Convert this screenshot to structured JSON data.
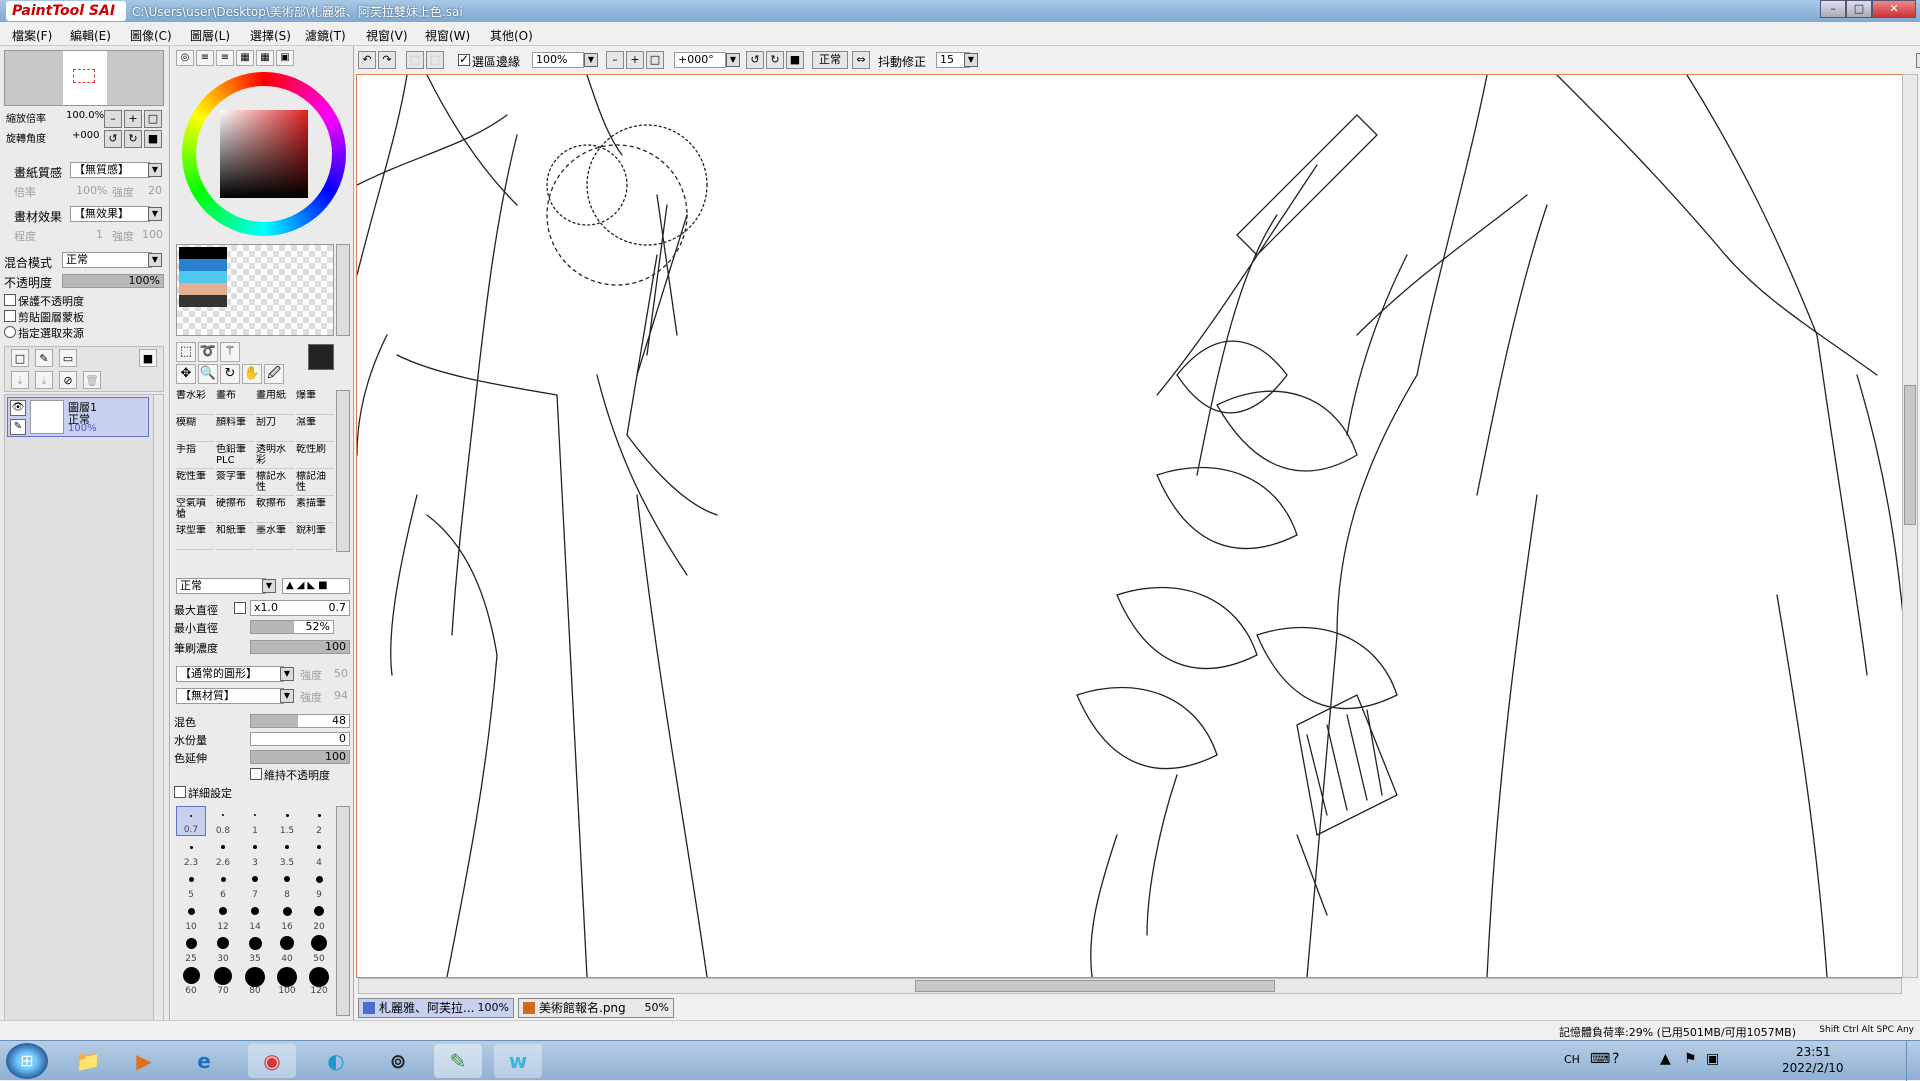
{
  "window": {
    "title": "C:\\Users\\user\\Desktop\\美術部\\札麗雅、阿芙拉雙妹上色.sai",
    "logo": "PaintTool SAI"
  },
  "menu": [
    "檔案(F)",
    "編輯(E)",
    "圖像(C)",
    "圖層(L)",
    "選擇(S)",
    "濾鏡(T)",
    "視窗(V)",
    "視窗(W)",
    "其他(O)"
  ],
  "navigator": {
    "zoom_label": "縮放倍率",
    "zoom_value": "100.0%",
    "rotate_label": "旋轉角度",
    "rotate_value": "+000"
  },
  "paper": {
    "texture_label": "畫紙質感",
    "texture_value": "【無質感】",
    "scale_label": "倍率",
    "scale_value": "100%",
    "strength_label": "強度",
    "strength_value": "20"
  },
  "effect": {
    "label": "畫材效果",
    "value": "【無效果】",
    "degree_label": "程度",
    "degree_value": "1",
    "strength_label": "強度",
    "strength_value": "100"
  },
  "blend": {
    "label": "混合模式",
    "value": "正常",
    "opacity_label": "不透明度",
    "opacity_value": "100%",
    "opacity": 1.0
  },
  "layer_options": [
    "保護不透明度",
    "剪貼圖層蒙板",
    "指定選取來源"
  ],
  "layer": {
    "name": "圖層1",
    "mode": "正常",
    "opacity": "100%"
  },
  "brushes": [
    [
      "書水彩",
      "畫布",
      "畫用紙",
      "爆筆"
    ],
    [
      "模糊",
      "顏料筆",
      "刮刀",
      "濕筆"
    ],
    [
      "手指",
      "色鉛筆PLC",
      "透明水彩",
      "乾性刷"
    ],
    [
      "乾性筆",
      "簽字筆",
      "標記水性",
      "標記油性"
    ],
    [
      "空氣噴槍",
      "硬擦布",
      "軟擦布",
      "素描筆"
    ],
    [
      "球型筆",
      "和紙筆",
      "墨水筆",
      "銳利筆"
    ]
  ],
  "brush_settings": {
    "mode": "正常",
    "max_label": "最大直徑",
    "max_mult": "x1.0",
    "max_value": "0.7",
    "min_label": "最小直徑",
    "min_value": "52%",
    "min_frac": 0.52,
    "density_label": "筆刷濃度",
    "density_value": "100",
    "density_frac": 1.0,
    "shape_value": "【通常的圓形】",
    "shape_strength_label": "強度",
    "shape_strength_value": "50",
    "texture_value": "【無材質】",
    "texture_strength_label": "強度",
    "texture_strength_value": "94",
    "mix_label": "混色",
    "mix_value": "48",
    "mix_frac": 0.48,
    "water_label": "水份量",
    "water_value": "0",
    "water_frac": 0,
    "extend_label": "色延伸",
    "extend_value": "100",
    "extend_frac": 1.0,
    "keep_opacity_label": "維持不透明度",
    "detail_label": "詳細設定"
  },
  "sizes": [
    "0.7",
    "0.8",
    "1",
    "1.5",
    "2",
    "2.3",
    "2.6",
    "3",
    "3.5",
    "4",
    "5",
    "6",
    "7",
    "8",
    "9",
    "10",
    "12",
    "14",
    "16",
    "20",
    "25",
    "30",
    "35",
    "40",
    "50",
    "60",
    "70",
    "80",
    "100",
    "120"
  ],
  "toolbar": {
    "selection_edge_label": "選區邊緣",
    "zoom_value": "100%",
    "angle_value": "+000°",
    "mode_value": "正常",
    "stabilizer_label": "抖動修正",
    "stabilizer_value": "15"
  },
  "doc_tabs": [
    {
      "name": "札麗雅、阿芙拉...",
      "zoom": "100%"
    },
    {
      "name": "美術館報名.png",
      "zoom": "50%"
    }
  ],
  "status": {
    "memory": "記憶體負荷率:29% (已用501MB/可用1057MB)",
    "keys": "Shift Ctrl Alt SPC Any"
  },
  "clock": {
    "time": "23:51",
    "date": "2022/2/10"
  },
  "tray_lang": "CH",
  "colors": {
    "accent": "#c8d0f0",
    "canvas_border": "#e08050",
    "taskbar": "#8fb1d4"
  }
}
